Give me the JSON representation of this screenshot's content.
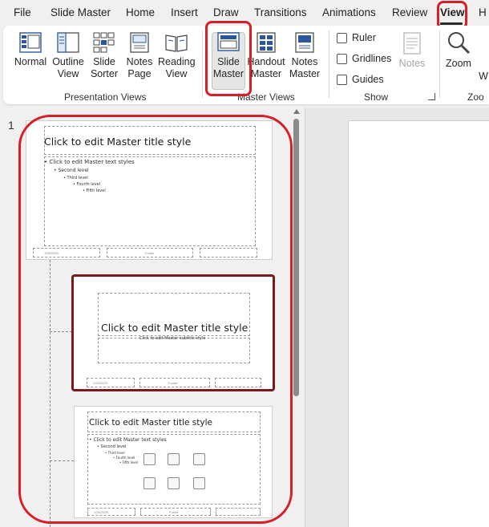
{
  "menu": {
    "items": [
      "File",
      "Slide Master",
      "Home",
      "Insert",
      "Draw",
      "Transitions",
      "Animations",
      "Review",
      "View",
      "H"
    ]
  },
  "ribbon": {
    "presentation_views": {
      "label": "Presentation Views",
      "buttons": [
        {
          "line1": "Normal",
          "line2": ""
        },
        {
          "line1": "Outline",
          "line2": "View"
        },
        {
          "line1": "Slide",
          "line2": "Sorter"
        },
        {
          "line1": "Notes",
          "line2": "Page"
        },
        {
          "line1": "Reading",
          "line2": "View"
        }
      ]
    },
    "master_views": {
      "label": "Master Views",
      "buttons": [
        {
          "line1": "Slide",
          "line2": "Master"
        },
        {
          "line1": "Handout",
          "line2": "Master"
        },
        {
          "line1": "Notes",
          "line2": "Master"
        }
      ]
    },
    "show": {
      "label": "Show",
      "ruler": "Ruler",
      "gridlines": "Gridlines",
      "guides": "Guides",
      "notes": "Notes"
    },
    "zoom": {
      "label": "Zoo",
      "button": "Zoom",
      "next": "W"
    }
  },
  "thumbnails": {
    "slide_number": "1",
    "master": {
      "title": "Click to edit Master title style",
      "levels": [
        "• Click to edit Master text styles",
        "• Second level",
        "• Third level",
        "• Fourth level",
        "• Fifth level"
      ],
      "footer_date": "1/25/2025",
      "footer_text": "Footer"
    },
    "layout1": {
      "title": "Click to edit Master title style",
      "subtitle": "Click to edit Master subtitle style",
      "footer_date": "1/25/2025",
      "footer_text": "Footer"
    },
    "layout2": {
      "title": "Click to edit Master title style",
      "levels": [
        "• Click to edit Master text styles",
        "• Second level",
        "• Third level",
        "• Fourth level",
        "• Fifth level"
      ],
      "footer_date": "1/25/2025",
      "footer_text": "Footer"
    }
  },
  "colors": {
    "highlight": "#d61f26",
    "selected_thumb": "#7b1a1e"
  }
}
